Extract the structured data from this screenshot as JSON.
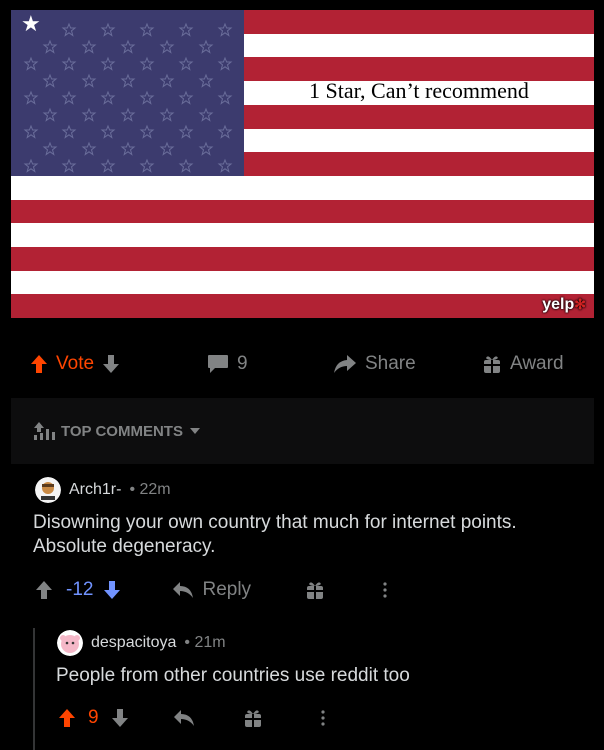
{
  "image": {
    "caption": "1 Star, Can’t recommend",
    "watermark": "yelp"
  },
  "post_actions": {
    "vote_label": "Vote",
    "comment_count": "9",
    "share_label": "Share",
    "award_label": "Award"
  },
  "comments_header": {
    "label": "TOP COMMENTS"
  },
  "comments": [
    {
      "author": "Arch1r-",
      "time": "22m",
      "body_line1": "Disowning your own country that much for internet points.",
      "body_line2": "Absolute degeneracy.",
      "score": "-12",
      "reply_label": "Reply"
    },
    {
      "author": "despacitoya",
      "time": "21m",
      "body_line1": "People from other countries use reddit too",
      "score": "9"
    }
  ],
  "colors": {
    "upvote_orange": "#ff4500",
    "downvote_blue": "#7193ff",
    "muted_gray": "#818384",
    "text": "#d7dadc"
  }
}
